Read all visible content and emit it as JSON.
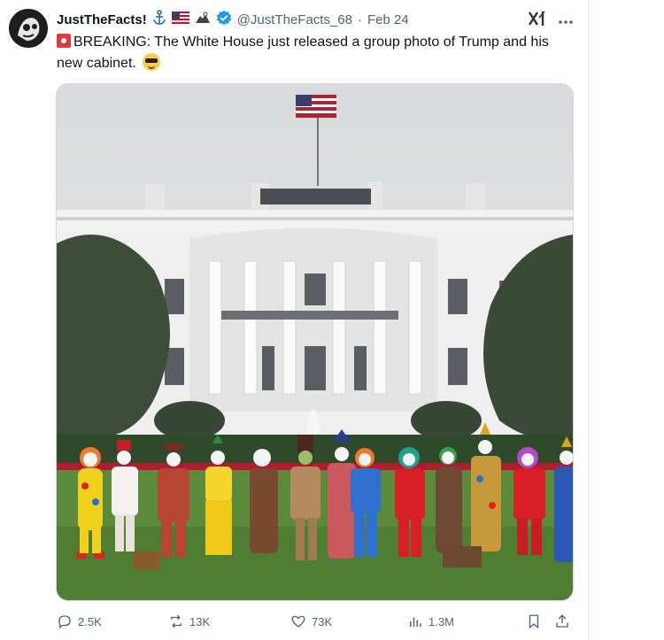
{
  "post": {
    "display_name": "JustTheFacts!",
    "handle": "@JustTheFacts_68",
    "separator": "·",
    "date": "Feb 24",
    "text": "BREAKING: The White House just released a group photo of Trump and his new cabinet."
  },
  "icons": [
    "anchor-icon",
    "us-flag-icon",
    "eagle-icon",
    "verified-badge-icon",
    "grok-icon",
    "more-icon",
    "siren-icon",
    "sunglasses-emoji-icon"
  ],
  "actions": {
    "replies": "2.5K",
    "reposts": "13K",
    "likes": "73K",
    "views": "1.3M"
  },
  "colors": {
    "verified": "#1d9bf0",
    "text": "#0f1419",
    "secondary": "#536471"
  }
}
